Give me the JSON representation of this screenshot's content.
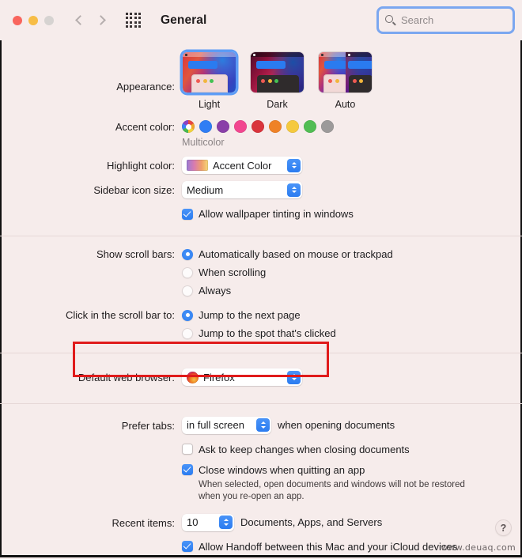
{
  "window": {
    "title": "General",
    "traffic_lights": [
      "close",
      "minimize",
      "zoom"
    ],
    "nav_back": "back",
    "nav_forward": "forward",
    "grid_button": "show-all"
  },
  "search": {
    "placeholder": "Search",
    "value": "",
    "focused": true
  },
  "appearance": {
    "label": "Appearance:",
    "selected": "Light",
    "options": [
      {
        "name": "Light"
      },
      {
        "name": "Dark"
      },
      {
        "name": "Auto"
      }
    ]
  },
  "accent_color": {
    "label": "Accent color:",
    "selected": "Multicolor",
    "selected_caption": "Multicolor",
    "swatches": [
      {
        "name": "Multicolor",
        "color": "multicolor"
      },
      {
        "name": "Blue",
        "color": "#2f7df4"
      },
      {
        "name": "Purple",
        "color": "#8a3fa8"
      },
      {
        "name": "Pink",
        "color": "#f2468f"
      },
      {
        "name": "Red",
        "color": "#d9343c"
      },
      {
        "name": "Orange",
        "color": "#ef8227"
      },
      {
        "name": "Yellow",
        "color": "#f5c93e"
      },
      {
        "name": "Green",
        "color": "#51bd53"
      },
      {
        "name": "Graphite",
        "color": "#9c9a9a"
      }
    ]
  },
  "highlight_color": {
    "label": "Highlight color:",
    "value": "Accent Color"
  },
  "sidebar_icon_size": {
    "label": "Sidebar icon size:",
    "value": "Medium"
  },
  "wallpaper_tinting": {
    "label": "Allow wallpaper tinting in windows",
    "checked": true
  },
  "scroll_bars": {
    "label": "Show scroll bars:",
    "selected": "Automatically based on mouse or trackpad",
    "options": [
      {
        "label": "Automatically based on mouse or trackpad",
        "checked": true
      },
      {
        "label": "When scrolling",
        "checked": false
      },
      {
        "label": "Always",
        "checked": false
      }
    ]
  },
  "scroll_bar_click": {
    "label": "Click in the scroll bar to:",
    "selected": "Jump to the next page",
    "options": [
      {
        "label": "Jump to the next page",
        "checked": true
      },
      {
        "label": "Jump to the spot that's clicked",
        "checked": false
      }
    ]
  },
  "default_browser": {
    "label": "Default web browser:",
    "value": "Firefox",
    "icon": "firefox-icon",
    "highlighted": true,
    "highlight_color": "#e01b1b"
  },
  "prefer_tabs": {
    "label": "Prefer tabs:",
    "value": "in full screen",
    "suffix": "when opening documents"
  },
  "ask_keep_changes": {
    "label": "Ask to keep changes when closing documents",
    "checked": false
  },
  "close_windows": {
    "label": "Close windows when quitting an app",
    "checked": true,
    "hint_line1": "When selected, open documents and windows will not be restored",
    "hint_line2": "when you re-open an app."
  },
  "recent_items": {
    "label": "Recent items:",
    "value": "10",
    "suffix": "Documents, Apps, and Servers"
  },
  "handoff": {
    "label": "Allow Handoff between this Mac and your iCloud devices",
    "checked": true
  },
  "help_button": {
    "glyph": "?"
  },
  "watermark": {
    "text": "www.deuaq.com"
  }
}
